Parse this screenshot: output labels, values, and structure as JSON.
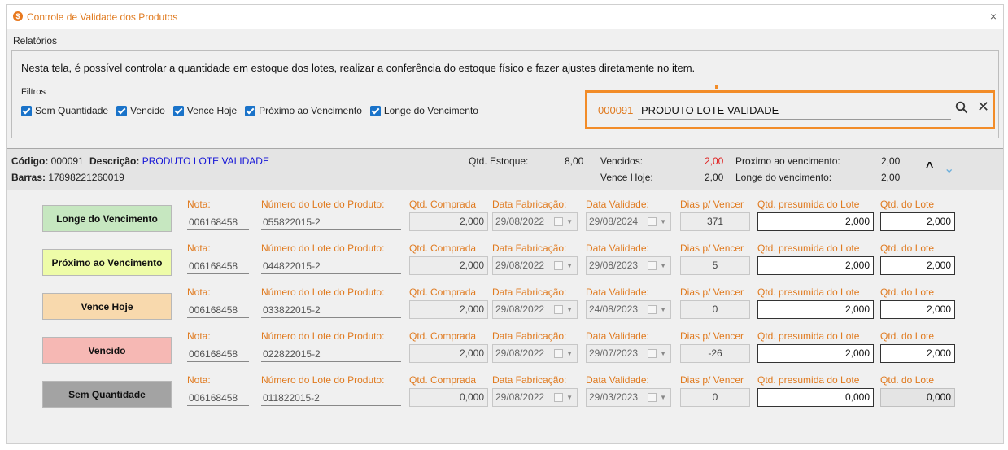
{
  "window": {
    "title": "Controle de Validade dos Produtos",
    "close": "×"
  },
  "menu": {
    "reports": "Relatórios"
  },
  "info_text": "Nesta tela, é possível controlar a quantidade em estoque dos lotes, realizar a conferência do estoque físico e fazer ajustes diretamente no item.",
  "filters": {
    "label": "Filtros",
    "items": [
      "Sem Quantidade",
      "Vencido",
      "Vence Hoje",
      "Próximo ao Vencimento",
      "Longe do Vencimento"
    ]
  },
  "search": {
    "code": "000091",
    "value": "PRODUTO LOTE VALIDADE",
    "clear": "✕"
  },
  "product": {
    "code_label": "Código:",
    "code": "000091",
    "desc_label": "Descrição:",
    "desc": "PRODUTO LOTE VALIDADE",
    "barcode_label": "Barras:",
    "barcode": "17898221260019",
    "stock_label": "Qtd. Estoque:",
    "stock": "8,00",
    "expired_label": "Vencidos:",
    "expired": "2,00",
    "today_label": "Vence Hoje:",
    "today": "2,00",
    "near_label": "Proximo ao vencimento:",
    "near": "2,00",
    "far_label": "Longe do vencimento:",
    "far": "2,00"
  },
  "labels": {
    "nota": "Nota:",
    "lote": "Número do Lote do Produto:",
    "comprada": "Qtd. Comprada",
    "fabricacao": "Data Fabricação:",
    "validade": "Data Validade:",
    "dias": "Dias p/ Vencer",
    "presumida": "Qtd. presumida do Lote",
    "qtd_lote": "Qtd. do Lote"
  },
  "rows": [
    {
      "status": "Longe do Vencimento",
      "color": "#c6e7c0",
      "nota": "006168458",
      "lote": "055822015-2",
      "comprada": "2,000",
      "fabricacao": "29/08/2022",
      "validade": "29/08/2024",
      "dias": "371",
      "presumida": "2,000",
      "qtd": "2,000"
    },
    {
      "status": "Próximo ao Vencimento",
      "color": "#eefca8",
      "nota": "006168458",
      "lote": "044822015-2",
      "comprada": "2,000",
      "fabricacao": "29/08/2022",
      "validade": "29/08/2023",
      "dias": "5",
      "presumida": "2,000",
      "qtd": "2,000"
    },
    {
      "status": "Vence Hoje",
      "color": "#f8d9ad",
      "nota": "006168458",
      "lote": "033822015-2",
      "comprada": "2,000",
      "fabricacao": "29/08/2022",
      "validade": "24/08/2023",
      "dias": "0",
      "presumida": "2,000",
      "qtd": "2,000"
    },
    {
      "status": "Vencido",
      "color": "#f6b8b4",
      "nota": "006168458",
      "lote": "022822015-2",
      "comprada": "2,000",
      "fabricacao": "29/08/2022",
      "validade": "29/07/2023",
      "dias": "-26",
      "presumida": "2,000",
      "qtd": "2,000"
    },
    {
      "status": "Sem Quantidade",
      "color": "#a3a3a3",
      "nota": "006168458",
      "lote": "011822015-2",
      "comprada": "0,000",
      "fabricacao": "29/08/2022",
      "validade": "29/03/2023",
      "dias": "0",
      "presumida": "0,000",
      "qtd": "0,000"
    }
  ]
}
